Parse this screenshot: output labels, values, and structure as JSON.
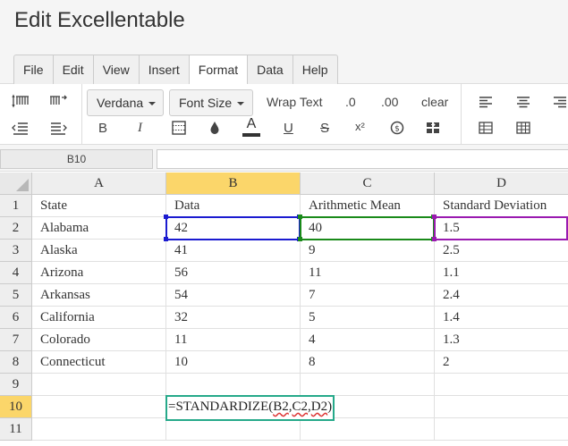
{
  "app": {
    "title": "Edit Excellentable"
  },
  "menu": {
    "tabs": [
      "File",
      "Edit",
      "View",
      "Insert",
      "Format",
      "Data",
      "Help"
    ],
    "active": "Format"
  },
  "toolbar": {
    "font_family": "Verdana",
    "font_size": "Font Size",
    "wrap_text": "Wrap Text",
    "decimal_decrease": ".0",
    "decimal_increase": ".00",
    "clear": "clear",
    "bold": "B",
    "italic": "I",
    "text_color_glyph": "A",
    "underline": "U",
    "strike": "S",
    "superscript": "x²",
    "colors": {
      "text_color_bar": "#333333"
    }
  },
  "formula_bar": {
    "cell_ref": "B10",
    "value": ""
  },
  "grid": {
    "columns": [
      "A",
      "B",
      "C",
      "D"
    ],
    "selected_column": "B",
    "rows": [
      "1",
      "2",
      "3",
      "4",
      "5",
      "6",
      "7",
      "8",
      "9",
      "10",
      "11"
    ],
    "selected_row": "10",
    "cells": [
      [
        "State",
        "Data",
        "Arithmetic Mean",
        "Standard Deviation"
      ],
      [
        "Alabama",
        "42",
        "40",
        "1.5"
      ],
      [
        "Alaska",
        "41",
        "9",
        "2.5"
      ],
      [
        "Arizona",
        "56",
        "11",
        "1.1"
      ],
      [
        "Arkansas",
        "54",
        "7",
        "2.4"
      ],
      [
        "California",
        "32",
        "5",
        "1.4"
      ],
      [
        "Colorado",
        "11",
        "4",
        "1.3"
      ],
      [
        "Connecticut",
        "10",
        "8",
        "2"
      ],
      [
        "",
        "",
        "",
        ""
      ],
      [
        "",
        "",
        "",
        ""
      ],
      [
        "",
        "",
        "",
        ""
      ]
    ],
    "colors": {
      "ref_b2": "#1b1bd0",
      "ref_c2": "#1a8a1a",
      "ref_d2": "#9a1ab0",
      "header_selected": "#fbd66a",
      "editor_border": "#26a98a"
    }
  },
  "editor": {
    "prefix": "=STANDARDIZE(",
    "ref1": "B2",
    "sep1": ",",
    "ref2": "C2",
    "sep2": ",",
    "ref3": "D2",
    "suffix": ")"
  }
}
